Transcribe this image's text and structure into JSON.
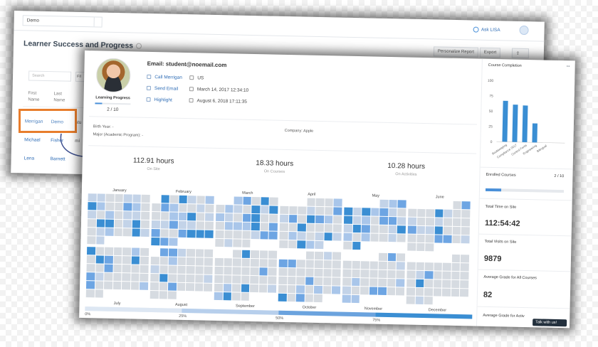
{
  "back": {
    "select_value": "Demo",
    "ask_label": "Ask LISA",
    "title": "Learner Success and Progress",
    "personalize_label": "Personalize Report",
    "export_label": "Export",
    "search_placeholder": "Search",
    "filter_label": "Fil",
    "headers": [
      "First Name",
      "Last Name"
    ],
    "rows": [
      {
        "first": "Merrigan",
        "last": "Demo",
        "extra": "stu"
      },
      {
        "first": "Michael",
        "last": "Fisher",
        "extra": "mi"
      },
      {
        "first": "Lena",
        "last": "Barnett",
        "extra": ""
      }
    ]
  },
  "profile": {
    "email": "Email: student@noemail.com",
    "learning_label": "Learning Progress",
    "progress": 0.2,
    "progress_text": "2 / 10",
    "call": "Call Merrigan",
    "send": "Send Email",
    "highlight": "Highlight",
    "country": "US",
    "date1": "March 14, 2017 12:34:10",
    "date2": "August 6, 2018 17:11:35",
    "birth": "Birth Year: -",
    "major": "Major (Academic Program): -",
    "company": "Company: Apple"
  },
  "stats": [
    {
      "value": "112.91 hours",
      "label": "On Site"
    },
    {
      "value": "18.33 hours",
      "label": "On Courses"
    },
    {
      "value": "10.28 hours",
      "label": "On Activities"
    }
  ],
  "months_top": [
    "January",
    "February",
    "March",
    "April",
    "May",
    "June"
  ],
  "months_bottom": [
    "July",
    "August",
    "September",
    "October",
    "November",
    "December"
  ],
  "percent_marks": [
    "0%",
    "25%",
    "50%",
    "75%"
  ],
  "right": {
    "completion_title": "Course Completion",
    "enrolled_label": "Enrolled Courses",
    "enrolled_value": "2 / 10",
    "enrolled_progress": 0.2,
    "time_label": "Total Time on Site",
    "time_value": "112:54:42",
    "visits_label": "Total Visits on Site",
    "visits_value": "9879",
    "grade_label": "Average Grade for All Courses",
    "grade_value": "82",
    "grade_label2": "Average Grade for Activ",
    "talk_label": "Talk with us!"
  },
  "chart_data": {
    "type": "bar",
    "title": "Course Completion",
    "categories": [
      "Bookkeeping",
      "Compliance 2017",
      "Control Fonts",
      "Engineering",
      "Bilingual"
    ],
    "values": [
      67,
      61,
      60,
      31,
      0
    ],
    "ylim": [
      0,
      100
    ],
    "yticks": [
      0,
      25,
      50,
      75,
      100
    ],
    "color": "#3a8ed3"
  },
  "colors": {
    "accent": "#4a90d9",
    "orange": "#e87d2c",
    "cell": "#d6dbe1"
  }
}
